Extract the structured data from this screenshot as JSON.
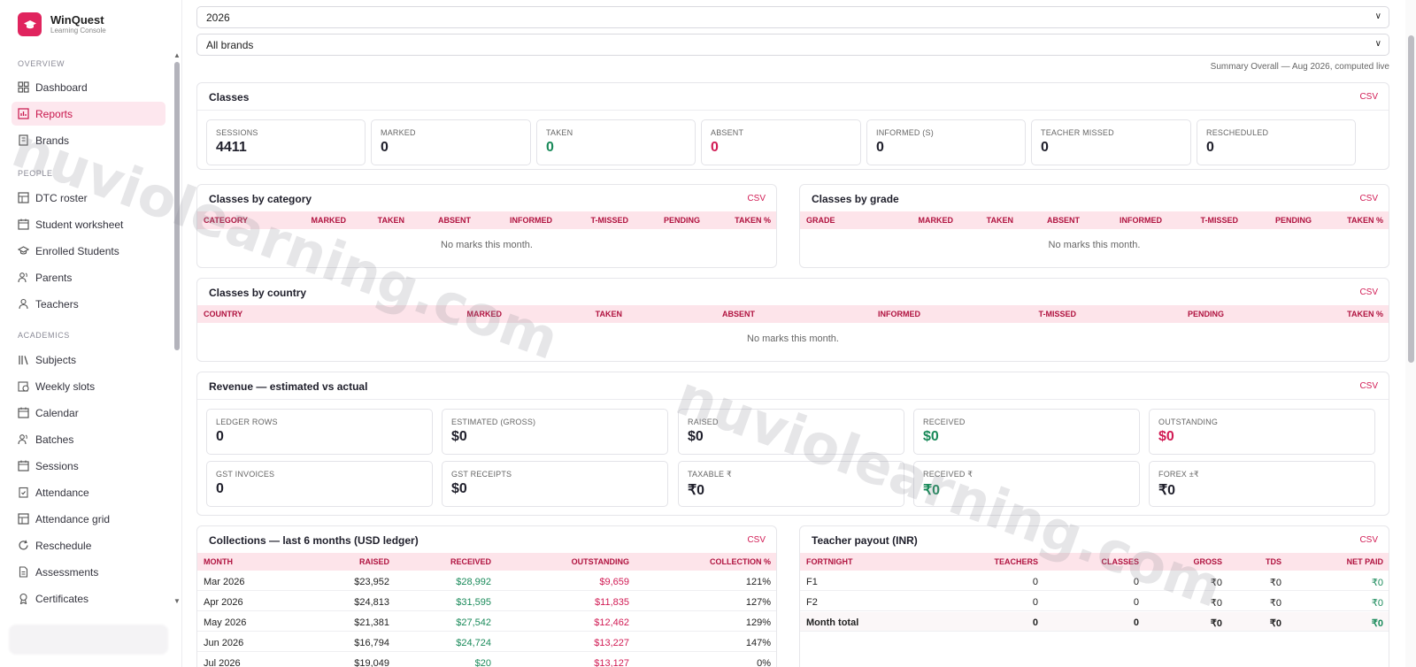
{
  "brand": {
    "name": "WinQuest",
    "subtitle": "Learning Console"
  },
  "sidebar": {
    "sections": [
      {
        "label": "OVERVIEW"
      },
      {
        "label": "PEOPLE"
      },
      {
        "label": "ACADEMICS"
      }
    ],
    "items": [
      {
        "label": "Dashboard",
        "icon": "grid-icon"
      },
      {
        "label": "Reports",
        "icon": "chart-icon",
        "active": true
      },
      {
        "label": "Brands",
        "icon": "building-icon"
      },
      {
        "label": "DTC roster",
        "icon": "table-icon"
      },
      {
        "label": "Student worksheet",
        "icon": "calendar-icon"
      },
      {
        "label": "Enrolled Students",
        "icon": "graduation-cap-icon"
      },
      {
        "label": "Parents",
        "icon": "users-icon"
      },
      {
        "label": "Teachers",
        "icon": "user-icon"
      },
      {
        "label": "Subjects",
        "icon": "books-icon"
      },
      {
        "label": "Weekly slots",
        "icon": "calendar-clock-icon"
      },
      {
        "label": "Calendar",
        "icon": "calendar-icon"
      },
      {
        "label": "Batches",
        "icon": "users-icon"
      },
      {
        "label": "Sessions",
        "icon": "calendar-icon"
      },
      {
        "label": "Attendance",
        "icon": "clipboard-check-icon"
      },
      {
        "label": "Attendance grid",
        "icon": "table-icon"
      },
      {
        "label": "Reschedule",
        "icon": "refresh-icon"
      },
      {
        "label": "Assessments",
        "icon": "document-icon"
      },
      {
        "label": "Certificates",
        "icon": "award-icon"
      }
    ]
  },
  "filters": {
    "year": "2026",
    "brand": "All brands"
  },
  "summary": "Summary Overall — Aug 2026, computed live",
  "csv_label": "CSV",
  "classes": {
    "title": "Classes",
    "stats": [
      {
        "label": "SESSIONS",
        "value": "4411",
        "tone": ""
      },
      {
        "label": "MARKED",
        "value": "0",
        "tone": ""
      },
      {
        "label": "TAKEN",
        "value": "0",
        "tone": "green"
      },
      {
        "label": "ABSENT",
        "value": "0",
        "tone": "red"
      },
      {
        "label": "INFORMED (S)",
        "value": "0",
        "tone": ""
      },
      {
        "label": "TEACHER MISSED",
        "value": "0",
        "tone": ""
      },
      {
        "label": "RESCHEDULED",
        "value": "0",
        "tone": ""
      }
    ]
  },
  "by_category": {
    "title": "Classes by category",
    "headers": [
      "CATEGORY",
      "MARKED",
      "TAKEN",
      "ABSENT",
      "INFORMED",
      "T-MISSED",
      "PENDING",
      "TAKEN %"
    ],
    "empty": "No marks this month."
  },
  "by_grade": {
    "title": "Classes by grade",
    "headers": [
      "GRADE",
      "MARKED",
      "TAKEN",
      "ABSENT",
      "INFORMED",
      "T-MISSED",
      "PENDING",
      "TAKEN %"
    ],
    "empty": "No marks this month."
  },
  "by_country": {
    "title": "Classes by country",
    "headers": [
      "COUNTRY",
      "MARKED",
      "TAKEN",
      "ABSENT",
      "INFORMED",
      "T-MISSED",
      "PENDING",
      "TAKEN %"
    ],
    "empty": "No marks this month."
  },
  "revenue": {
    "title": "Revenue — estimated vs actual",
    "stats": [
      {
        "label": "LEDGER ROWS",
        "value": "0",
        "tone": ""
      },
      {
        "label": "ESTIMATED (GROSS)",
        "value": "$0",
        "tone": ""
      },
      {
        "label": "RAISED",
        "value": "$0",
        "tone": ""
      },
      {
        "label": "RECEIVED",
        "value": "$0",
        "tone": "green"
      },
      {
        "label": "OUTSTANDING",
        "value": "$0",
        "tone": "red"
      },
      {
        "label": "GST INVOICES",
        "value": "0",
        "tone": ""
      },
      {
        "label": "GST RECEIPTS",
        "value": "$0",
        "tone": ""
      },
      {
        "label": "TAXABLE ₹",
        "value": "₹0",
        "tone": ""
      },
      {
        "label": "RECEIVED ₹",
        "value": "₹0",
        "tone": "green"
      },
      {
        "label": "FOREX ±₹",
        "value": "₹0",
        "tone": ""
      }
    ]
  },
  "collections": {
    "title": "Collections — last 6 months (USD ledger)",
    "headers": [
      "MONTH",
      "RAISED",
      "RECEIVED",
      "OUTSTANDING",
      "COLLECTION %"
    ],
    "rows": [
      [
        "Mar 2026",
        "$23,952",
        "$28,992",
        "$9,659",
        "121%"
      ],
      [
        "Apr 2026",
        "$24,813",
        "$31,595",
        "$11,835",
        "127%"
      ],
      [
        "May 2026",
        "$21,381",
        "$27,542",
        "$12,462",
        "129%"
      ],
      [
        "Jun 2026",
        "$16,794",
        "$24,724",
        "$13,227",
        "147%"
      ],
      [
        "Jul 2026",
        "$19,049",
        "$20",
        "$13,127",
        "0%"
      ]
    ]
  },
  "payout": {
    "title": "Teacher payout (INR)",
    "headers": [
      "FORTNIGHT",
      "TEACHERS",
      "CLASSES",
      "GROSS",
      "TDS",
      "NET PAID"
    ],
    "rows": [
      [
        "F1",
        "0",
        "0",
        "₹0",
        "₹0",
        "₹0"
      ],
      [
        "F2",
        "0",
        "0",
        "₹0",
        "₹0",
        "₹0"
      ],
      [
        "Month total",
        "0",
        "0",
        "₹0",
        "₹0",
        "₹0"
      ]
    ]
  },
  "watermark": "nuviolearning.com",
  "colors": {
    "accent": "#d11b54",
    "green": "#1a8a5a",
    "header_bg": "#fde4ea",
    "active_bg": "#fde7ee"
  }
}
